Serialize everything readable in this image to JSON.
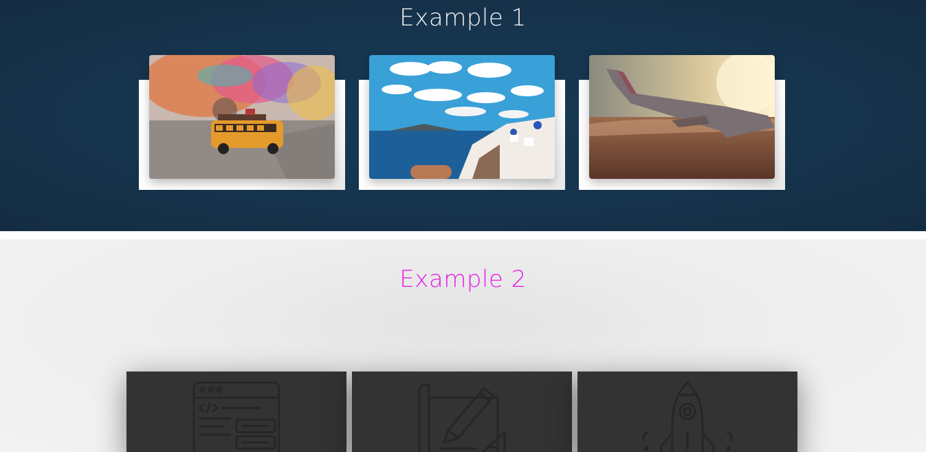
{
  "example1": {
    "title": "Example 1",
    "cards": [
      {
        "image": "toy-bus-photo"
      },
      {
        "image": "santorini-photo"
      },
      {
        "image": "airplane-wing-photo"
      }
    ]
  },
  "example2": {
    "title": "Example 2",
    "title_color": "#e61ee6",
    "cards": [
      {
        "icon": "code-window-icon"
      },
      {
        "icon": "design-pencil-icon"
      },
      {
        "icon": "rocket-icon"
      }
    ]
  },
  "colors": {
    "section1_bg": "#16344d",
    "section2_bg": "#f0f0f0",
    "card2_bg": "#333333"
  }
}
